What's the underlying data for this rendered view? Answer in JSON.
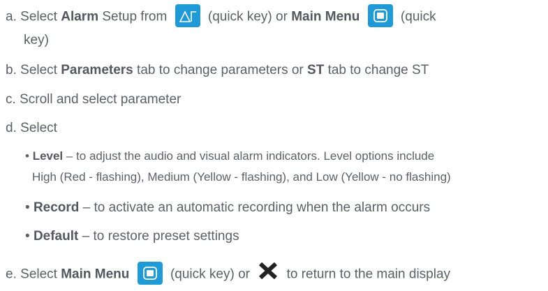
{
  "steps": {
    "a": {
      "marker": "a.",
      "t1": "Select ",
      "b1": "Alarm",
      "t2": " Setup from",
      "t3": "(quick key) or",
      "b2": "Main Menu",
      "t4": "(quick",
      "t5": "key)"
    },
    "b": {
      "marker": "b.",
      "t1": "Select ",
      "b1": "Parameters",
      "t2": " tab to change parameters or ",
      "b2": "ST",
      "t3": " tab to change ST"
    },
    "c": {
      "marker": "c.",
      "text": "Scroll and select parameter"
    },
    "d": {
      "marker": "d.",
      "text": "Select",
      "bullets": [
        {
          "bullet": "•",
          "bold": "Level",
          "text": " – to adjust the audio and visual alarm indicators. Level options include",
          "cont": "High (Red - flashing), Medium (Yellow - flashing), and Low (Yellow - no flashing)"
        },
        {
          "bullet": "•",
          "bold": "Record",
          "text": " – to activate an automatic recording when the alarm occurs"
        },
        {
          "bullet": "•",
          "bold": "Default",
          "text": " – to restore preset settings"
        }
      ]
    },
    "e": {
      "marker": "e.",
      "t1": "Select ",
      "b1": "Main Menu",
      "t2": "(quick key) or",
      "t3": "to return to the main display"
    }
  },
  "icons": {
    "alarm_setup_key": "alarm-setup-icon",
    "main_menu_key": "main-menu-icon",
    "close": "close-icon"
  },
  "colors": {
    "text": "#5c5f66",
    "quick_key_blue": "#1f9ad6",
    "close_mark": "#222222"
  }
}
